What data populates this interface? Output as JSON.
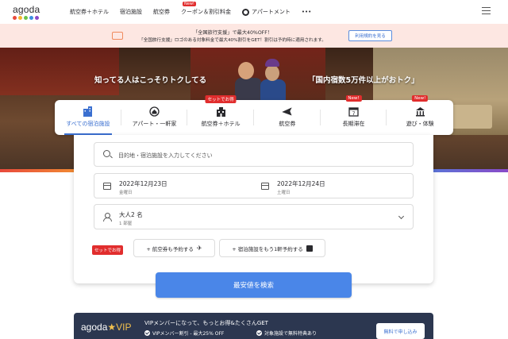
{
  "logo": {
    "text": "agoda",
    "dot_colors": [
      "#e84a3c",
      "#f7b52c",
      "#6cc24a",
      "#3a8fe0",
      "#8a4ac8"
    ]
  },
  "nav": {
    "items": [
      {
        "label": "航空券＋ホテル"
      },
      {
        "label": "宿泊施設"
      },
      {
        "label": "航空券"
      },
      {
        "label": "クーポン＆割引料金",
        "badge": "New!"
      },
      {
        "label": "アパートメント"
      },
      {
        "label": "•••"
      }
    ],
    "menu_icon": "hamburger-icon"
  },
  "banner": {
    "line1": "「全国旅行支援」で最大40%OFF！",
    "line2": "「全国旅行支援」ロゴのある対象料金で最大40%割引をGET！割引は予約時に適用されます。",
    "button": "利用規約を見る"
  },
  "hero": {
    "left_text": "知ってる人はこっそりトクしてる",
    "right_text": "「国内宿数5万件以上がおトク」"
  },
  "tabs": [
    {
      "label": "すべての宿泊施設",
      "icon": "building-icon",
      "active": true
    },
    {
      "label": "アパート・一軒家",
      "icon": "house-icon"
    },
    {
      "label": "航空券＋ホテル",
      "icon": "flight-hotel-icon",
      "badge": "セットでお得"
    },
    {
      "label": "航空券",
      "icon": "plane-icon"
    },
    {
      "label": "長期滞在",
      "icon": "calendar-icon",
      "badge": "New!"
    },
    {
      "label": "遊び・体験",
      "icon": "activity-icon",
      "badge": "New!"
    }
  ],
  "search": {
    "placeholder": "目的地・宿泊施設を入力してください",
    "checkin": {
      "date": "2022年12月23日",
      "day": "金曜日"
    },
    "checkout": {
      "date": "2022年12月24日",
      "day": "土曜日"
    },
    "guests": {
      "main": "大人2 名",
      "sub": "1 部屋"
    },
    "set_badge": "セットでお得",
    "addon_flight": "+ 航空券も予約する",
    "addon_hotel": "+ 宿泊施設をもう1軒予約する",
    "submit": "最安値を検索"
  },
  "vip": {
    "logo_main": "agoda",
    "logo_star": "★VIP",
    "title": "VIPメンバーになって、もっとお得&たくさんGET",
    "benefit1": "VIPメンバー割引 - 最大25% OFF",
    "benefit2": "対象施設で無料特典あり",
    "button": "無料で申し込み"
  },
  "colors": {
    "accent": "#4a86e8",
    "badge_red": "#e12d2d",
    "vip_bg": "#2c3750"
  }
}
